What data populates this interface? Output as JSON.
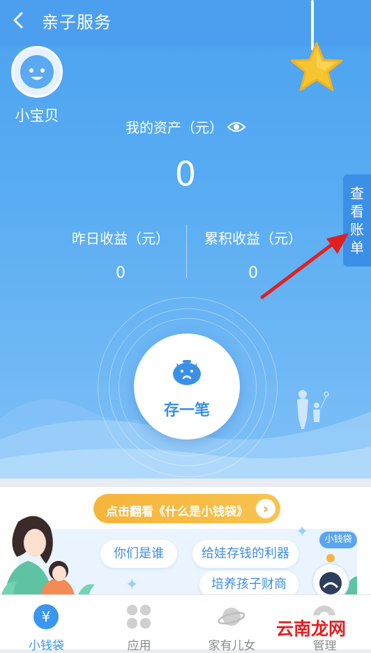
{
  "colors": {
    "primary": "#4ca2f0",
    "accent": "#3a96ef",
    "banner": "#f6b43a",
    "annotation_arrow": "#e02020"
  },
  "header": {
    "title": "亲子服务",
    "back_icon": "chevron-left-icon"
  },
  "profile": {
    "name": "小宝贝",
    "avatar_icon": "baby-face-icon"
  },
  "assets": {
    "label": "我的资产（元）",
    "value": "0",
    "visibility_icon": "eye-icon"
  },
  "stats": [
    {
      "label": "昨日收益（元）",
      "value": "0"
    },
    {
      "label": "累积收益（元）",
      "value": "0"
    }
  ],
  "side_tab": {
    "chars": [
      "查",
      "看",
      "账",
      "单"
    ]
  },
  "deposit": {
    "label": "存一笔",
    "icon": "piggy-bank-icon"
  },
  "promo": {
    "banner_text": "点击翻看《什么是小钱袋》",
    "badge": "小钱袋",
    "chips": [
      "你们是谁",
      "给娃存钱的利器",
      "培养孩子财商"
    ]
  },
  "tabbar": {
    "items": [
      {
        "label": "小钱袋",
        "icon": "yuan-coin-icon",
        "active": true
      },
      {
        "label": "应用",
        "icon": "clover-grid-icon",
        "active": false
      },
      {
        "label": "家有儿女",
        "icon": "planet-icon",
        "active": false
      },
      {
        "label": "管理",
        "icon": "settings-icon",
        "active": false
      }
    ]
  },
  "watermark": "云南龙网"
}
